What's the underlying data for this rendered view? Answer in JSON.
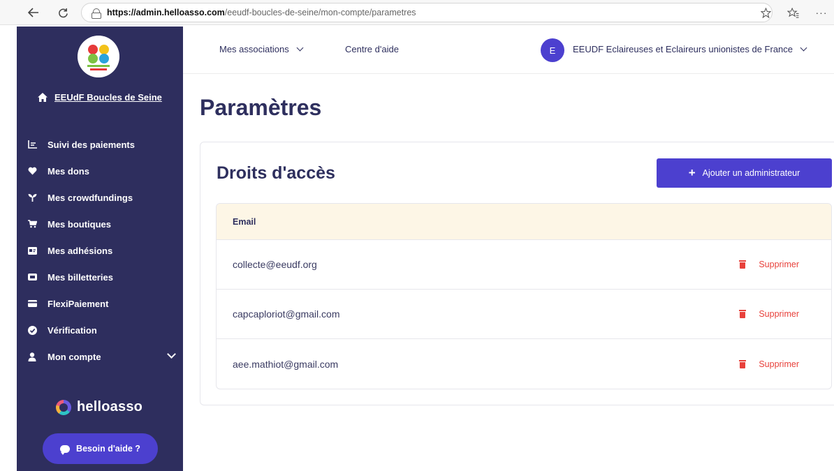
{
  "browser": {
    "url_domain": "https://admin.helloasso.com",
    "url_path": "/eeudf-boucles-de-seine/mon-compte/parametres"
  },
  "sidebar": {
    "org_name": "EEUdF Boucles de Seine",
    "items": [
      {
        "label": "Suivi des paiements",
        "icon": "chart-icon"
      },
      {
        "label": "Mes dons",
        "icon": "heart-icon"
      },
      {
        "label": "Mes crowdfundings",
        "icon": "sprout-icon"
      },
      {
        "label": "Mes boutiques",
        "icon": "cart-icon"
      },
      {
        "label": "Mes adhésions",
        "icon": "card-icon"
      },
      {
        "label": "Mes billetteries",
        "icon": "ticket-icon"
      },
      {
        "label": "FlexiPaiement",
        "icon": "creditcard-icon"
      },
      {
        "label": "Vérification",
        "icon": "check-badge-icon"
      },
      {
        "label": "Mon compte",
        "icon": "user-icon"
      }
    ],
    "brand": "helloasso",
    "help_label": "Besoin d'aide ?"
  },
  "topbar": {
    "associations_label": "Mes associations",
    "help_center_label": "Centre d'aide",
    "avatar_letter": "E",
    "account_name": "EEUDF Eclaireuses et Eclaireurs unionistes de France"
  },
  "main": {
    "page_title": "Paramètres",
    "card_title": "Droits d'accès",
    "add_button_label": "Ajouter un administrateur",
    "table_header": "Email",
    "delete_label": "Supprimer",
    "rows": [
      {
        "email": "collecte@eeudf.org"
      },
      {
        "email": "capcaploriot@gmail.com"
      },
      {
        "email": "aee.mathiot@gmail.com"
      }
    ]
  },
  "colors": {
    "sidebar_bg": "#2e2e5e",
    "accent": "#4c40cf",
    "danger": "#e8413b",
    "table_header_bg": "#fdf6e6"
  }
}
